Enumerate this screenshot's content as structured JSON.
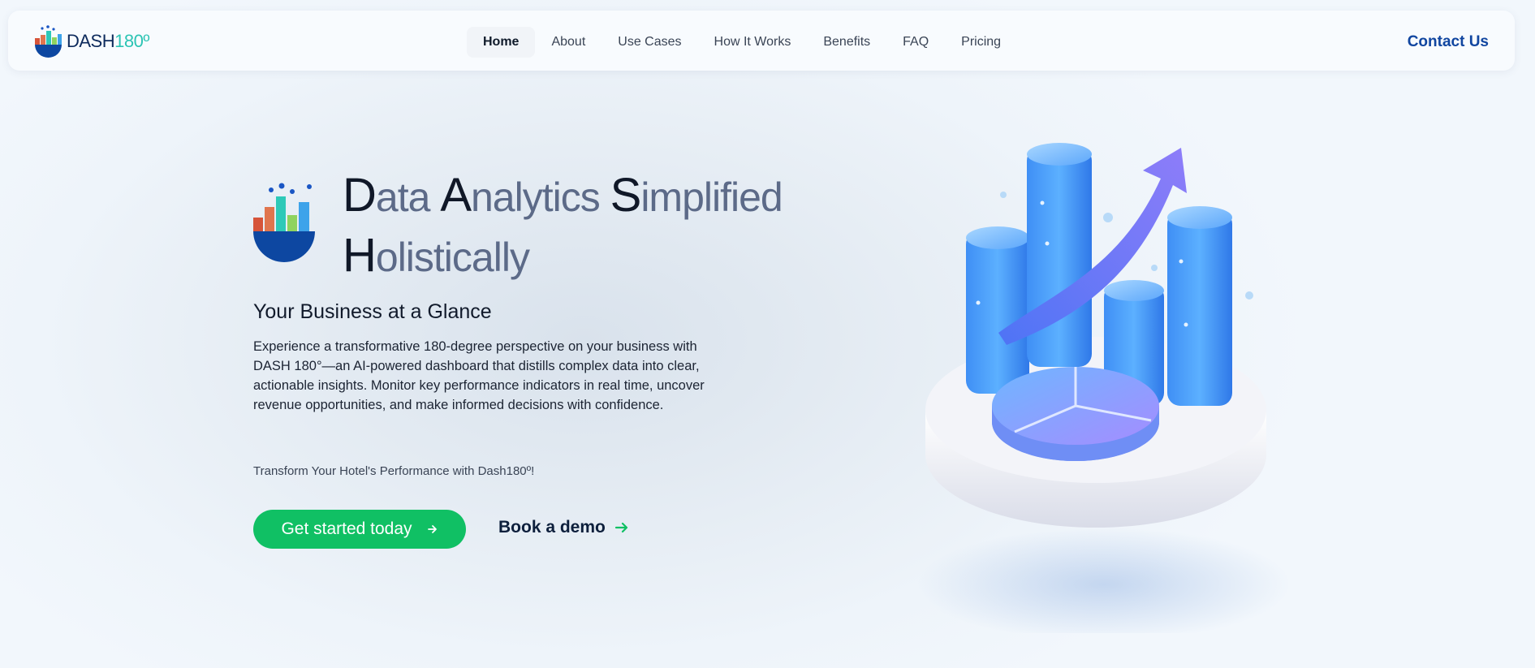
{
  "header": {
    "logo": {
      "dash": "DASH",
      "num": "180º"
    },
    "nav": [
      "Home",
      "About",
      "Use Cases",
      "How It Works",
      "Benefits",
      "FAQ",
      "Pricing"
    ],
    "contact_label": "Contact Us"
  },
  "hero": {
    "headline": {
      "line1": [
        {
          "cap": "D",
          "rest": "ata"
        },
        {
          "cap": "A",
          "rest": "nalytics"
        },
        {
          "cap": "S",
          "rest": "implified"
        }
      ],
      "line2": [
        {
          "cap": "H",
          "rest": "olistically"
        }
      ]
    },
    "subtitle": "Your Business at a Glance",
    "description": "Experience a transformative 180-degree perspective on your business with DASH 180°—an AI-powered dashboard that distills complex data into clear, actionable insights. Monitor key performance indicators in real time, uncover revenue opportunities, and make informed decisions with confidence.",
    "tagline": "Transform Your Hotel's Performance with Dash180º!",
    "primary_cta": "Get started today",
    "secondary_cta": "Book a demo"
  },
  "colors": {
    "brand_blue": "#1146a0",
    "brand_teal": "#2cc4b4",
    "cta_green": "#10c064"
  },
  "icons": {
    "primary_cta_arrow": "arrow-right-icon",
    "secondary_cta_arrow": "arrow-right-icon"
  }
}
